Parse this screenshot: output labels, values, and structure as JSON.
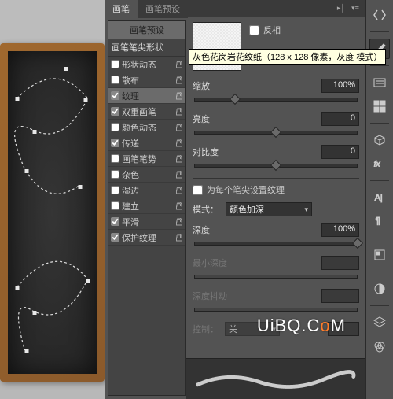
{
  "tabs": {
    "main": "画笔",
    "preset": "画笔预设"
  },
  "list": {
    "header": "画笔预设",
    "subheader": "画笔笔尖形状",
    "items": [
      {
        "label": "形状动态",
        "checked": false
      },
      {
        "label": "散布",
        "checked": false
      },
      {
        "label": "纹理",
        "checked": true,
        "selected": true
      },
      {
        "label": "双重画笔",
        "checked": true
      },
      {
        "label": "颜色动态",
        "checked": false
      },
      {
        "label": "传递",
        "checked": true
      },
      {
        "label": "画笔笔势",
        "checked": false
      },
      {
        "label": "杂色",
        "checked": false
      },
      {
        "label": "湿边",
        "checked": false
      },
      {
        "label": "建立",
        "checked": false
      },
      {
        "label": "平滑",
        "checked": true
      },
      {
        "label": "保护纹理",
        "checked": true
      }
    ]
  },
  "texture": {
    "invert_label": "反相",
    "tooltip": "灰色花岗岩花纹纸（128 x 128 像素，灰度 模式）",
    "scale_label": "缩放",
    "scale_value": "100%",
    "brightness_label": "亮度",
    "brightness_value": "0",
    "contrast_label": "对比度",
    "contrast_value": "0",
    "each_tip_label": "为每个笔尖设置纹理",
    "mode_label": "模式：",
    "mode_value": "颜色加深",
    "depth_label": "深度",
    "depth_value": "100%",
    "min_depth_label": "最小深度",
    "depth_jitter_label": "深度抖动",
    "control_label": "控制：",
    "control_value": "关"
  },
  "watermark_plain": "UiBQ.C",
  "watermark_accent": "o",
  "watermark_tail": "M"
}
